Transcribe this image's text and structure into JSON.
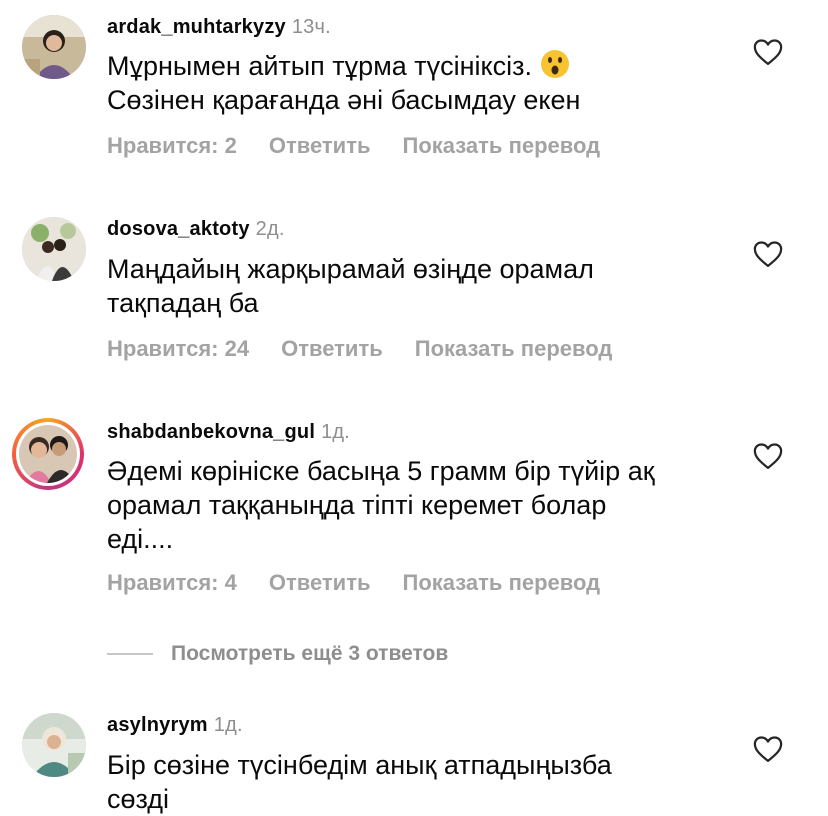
{
  "comments": [
    {
      "username": "ardak_muhtarkyzy",
      "time": "13ч.",
      "text_line1": "Мұрнымен айтып  тұрма түсініксіз.",
      "text_line2": "Сөзінен қарағанда әні басымдау екен",
      "emoji": "astonished-face-emoji",
      "likes_label": "Нравится: 2",
      "reply_label": "Ответить",
      "translate_label": "Показать перевод"
    },
    {
      "username": "dosova_aktoty",
      "time": "2д.",
      "text_line1": "Маңдайың жарқырамай өзіңде орамал",
      "text_line2": "тақпадаң ба",
      "likes_label": "Нравится: 24",
      "reply_label": "Ответить",
      "translate_label": "Показать перевод"
    },
    {
      "username": "shabdanbekovna_gul",
      "time": "1д.",
      "text_line1": "Әдемі көрініске басыңа 5 грамм бір түйір ақ",
      "text_line2": "орамал таққаныңда тіпті керемет болар",
      "text_line3": "еді....",
      "likes_label": "Нравится: 4",
      "reply_label": "Ответить",
      "translate_label": "Показать перевод",
      "view_replies_label": "Посмотреть ещё 3 ответов"
    },
    {
      "username": "asylnyrym",
      "time": "1д.",
      "text_line1": "Бір сөзіне түсінбедім анық атпадыңызба",
      "text_line2": "сөзді"
    }
  ],
  "icons": {
    "like": "heart-outline-icon"
  },
  "colors": {
    "text": "#0a0a0a",
    "muted": "#8e8e8e",
    "action": "#a3a3a3",
    "background": "#ffffff"
  }
}
